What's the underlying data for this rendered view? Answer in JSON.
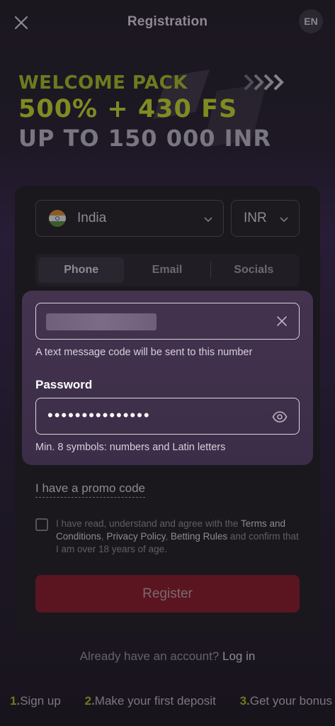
{
  "header": {
    "title": "Registration",
    "language": "EN"
  },
  "banner": {
    "line1": "WELCOME PACK",
    "line2": "500% + 430 FS",
    "line3": "UP TO 150 000 INR"
  },
  "form": {
    "country": "India",
    "currency": "INR",
    "tabs": [
      {
        "label": "Phone",
        "active": true
      },
      {
        "label": "Email",
        "active": false
      },
      {
        "label": "Socials",
        "active": false
      }
    ],
    "phone_hint": "A text message code will be sent to this number",
    "password_label": "Password",
    "password_value": "•••••••••••••••",
    "password_hint": "Min. 8 symbols: numbers and Latin letters",
    "promo_link": "I have a promo code",
    "terms": {
      "prefix": "I have read, understand and agree with the ",
      "terms_link": "Terms and Conditions",
      "sep1": ", ",
      "privacy_link": "Privacy Policy",
      "sep2": ", ",
      "betting_link": "Betting Rules",
      "suffix": " and confirm that I am over 18 years of age."
    },
    "register_label": "Register"
  },
  "login": {
    "prompt": "Already have an account? ",
    "link": "Log in"
  },
  "steps": [
    {
      "num": "1.",
      "label": "Sign up"
    },
    {
      "num": "2.",
      "label": "Make your first deposit"
    },
    {
      "num": "3.",
      "label": "Get your bonus"
    }
  ],
  "colors": {
    "accent_lime": "#6e7a1e",
    "register_bg": "#5a1520",
    "panel_bg": "#44334f"
  }
}
